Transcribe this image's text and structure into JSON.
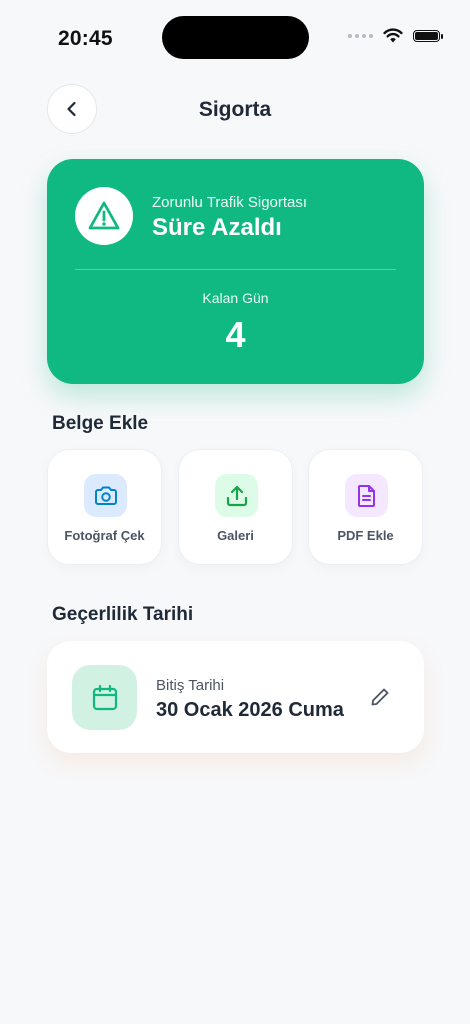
{
  "status_bar": {
    "time": "20:45"
  },
  "nav": {
    "title": "Sigorta"
  },
  "hero": {
    "subtitle": "Zorunlu Trafik Sigortası",
    "title": "Süre Azaldı",
    "days_label": "Kalan Gün",
    "days_value": "4",
    "color": "#10b981"
  },
  "documents": {
    "section_title": "Belge Ekle",
    "items": [
      {
        "label": "Fotoğraf Çek",
        "icon": "camera-icon"
      },
      {
        "label": "Galeri",
        "icon": "upload-icon"
      },
      {
        "label": "PDF Ekle",
        "icon": "document-icon"
      }
    ]
  },
  "validity": {
    "section_title": "Geçerlilik Tarihi",
    "label": "Bitiş Tarihi",
    "date": "30 Ocak 2026 Cuma",
    "icon": "calendar-icon",
    "edit_icon": "pencil-icon"
  }
}
